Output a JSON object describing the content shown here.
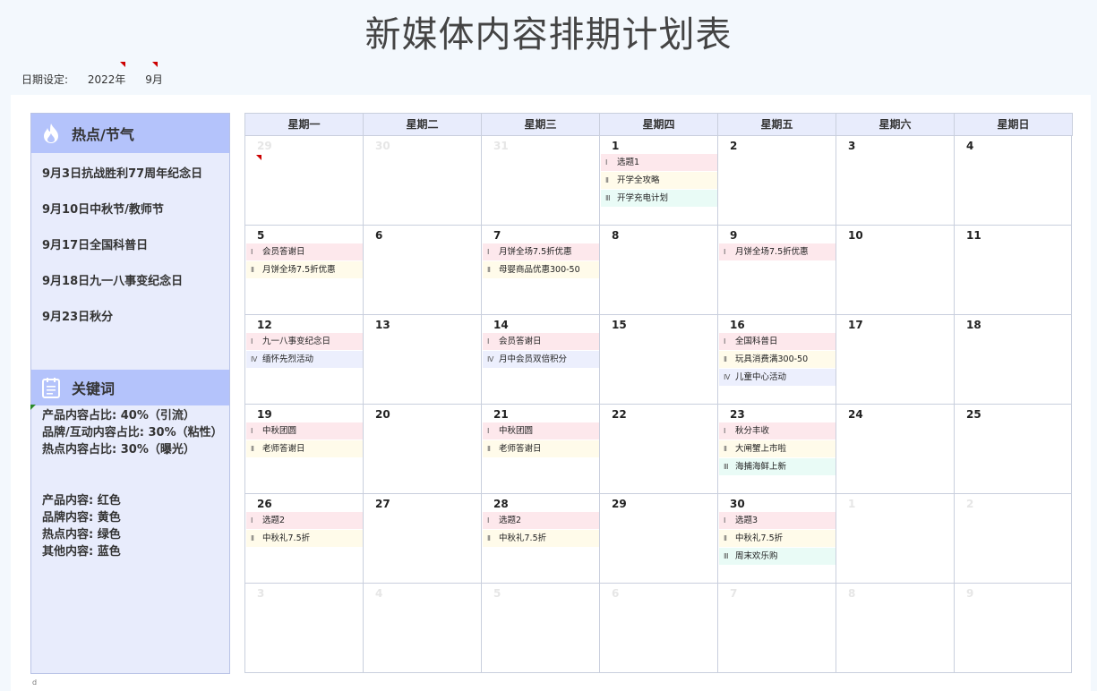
{
  "page": {
    "title": "新媒体内容排期计划表"
  },
  "date_setting": {
    "label": "日期设定:",
    "year": "2022年",
    "month": "9月"
  },
  "hot": {
    "heading": "热点/节气",
    "items": [
      "9月3日抗战胜利77周年纪念日",
      "9月10日中秋节/教师节",
      "9月17日全国科普日",
      "9月18日九一八事变纪念日",
      "9月23日秋分"
    ]
  },
  "keywords": {
    "heading": "关键词",
    "ratios": [
      "产品内容占比: 40%（引流）",
      "品牌/互动内容占比: 30%（粘性）",
      "热点内容占比: 30%（曝光）"
    ],
    "colors": [
      "产品内容: 红色",
      "品牌内容: 黄色",
      "热点内容: 绿色",
      "其他内容: 蓝色"
    ]
  },
  "calendar": {
    "weekdays": [
      "星期一",
      "星期二",
      "星期三",
      "星期四",
      "星期五",
      "星期六",
      "星期日"
    ],
    "weeks": [
      [
        {
          "day": "29",
          "dim": true,
          "events": []
        },
        {
          "day": "30",
          "dim": true,
          "events": []
        },
        {
          "day": "31",
          "dim": true,
          "events": []
        },
        {
          "day": "1",
          "events": [
            {
              "n": "Ⅰ",
              "text": "选题1",
              "c": "c1"
            },
            {
              "n": "Ⅱ",
              "text": "开学全攻略",
              "c": "c2"
            },
            {
              "n": "Ⅲ",
              "text": "开学充电计划",
              "c": "c3"
            }
          ]
        },
        {
          "day": "2",
          "events": []
        },
        {
          "day": "3",
          "events": []
        },
        {
          "day": "4",
          "events": []
        }
      ],
      [
        {
          "day": "5",
          "events": [
            {
              "n": "Ⅰ",
              "text": "会员答谢日",
              "c": "c1"
            },
            {
              "n": "Ⅱ",
              "text": "月饼全场7.5折优惠",
              "c": "c2"
            }
          ]
        },
        {
          "day": "6",
          "events": []
        },
        {
          "day": "7",
          "events": [
            {
              "n": "Ⅰ",
              "text": "月饼全场7.5折优惠",
              "c": "c1"
            },
            {
              "n": "Ⅱ",
              "text": "母婴商品优惠300-50",
              "c": "c2"
            }
          ]
        },
        {
          "day": "8",
          "events": []
        },
        {
          "day": "9",
          "events": [
            {
              "n": "Ⅰ",
              "text": "月饼全场7.5折优惠",
              "c": "c1"
            }
          ]
        },
        {
          "day": "10",
          "events": []
        },
        {
          "day": "11",
          "events": []
        }
      ],
      [
        {
          "day": "12",
          "events": [
            {
              "n": "Ⅰ",
              "text": "九一八事变纪念日",
              "c": "c1"
            },
            {
              "n": "Ⅳ",
              "text": "缅怀先烈活动",
              "c": "c4"
            }
          ]
        },
        {
          "day": "13",
          "events": []
        },
        {
          "day": "14",
          "events": [
            {
              "n": "Ⅰ",
              "text": "会员答谢日",
              "c": "c1"
            },
            {
              "n": "Ⅳ",
              "text": "月中会员双倍积分",
              "c": "c4"
            }
          ]
        },
        {
          "day": "15",
          "events": []
        },
        {
          "day": "16",
          "events": [
            {
              "n": "Ⅰ",
              "text": "全国科普日",
              "c": "c1"
            },
            {
              "n": "Ⅱ",
              "text": "玩具消费满300-50",
              "c": "c2"
            },
            {
              "n": "Ⅳ",
              "text": "儿童中心活动",
              "c": "c4"
            }
          ]
        },
        {
          "day": "17",
          "events": []
        },
        {
          "day": "18",
          "events": []
        }
      ],
      [
        {
          "day": "19",
          "events": [
            {
              "n": "Ⅰ",
              "text": "中秋团圆",
              "c": "c1"
            },
            {
              "n": "Ⅱ",
              "text": "老师答谢日",
              "c": "c2"
            }
          ]
        },
        {
          "day": "20",
          "events": []
        },
        {
          "day": "21",
          "events": [
            {
              "n": "Ⅰ",
              "text": "中秋团圆",
              "c": "c1"
            },
            {
              "n": "Ⅱ",
              "text": "老师答谢日",
              "c": "c2"
            }
          ]
        },
        {
          "day": "22",
          "events": []
        },
        {
          "day": "23",
          "events": [
            {
              "n": "Ⅰ",
              "text": "秋分丰收",
              "c": "c1"
            },
            {
              "n": "Ⅱ",
              "text": "大闸蟹上市啦",
              "c": "c2"
            },
            {
              "n": "Ⅲ",
              "text": "海捕海鲜上新",
              "c": "c3"
            }
          ]
        },
        {
          "day": "24",
          "events": []
        },
        {
          "day": "25",
          "events": []
        }
      ],
      [
        {
          "day": "26",
          "events": [
            {
              "n": "Ⅰ",
              "text": "选题2",
              "c": "c1"
            },
            {
              "n": "Ⅱ",
              "text": "中秋礼7.5折",
              "c": "c2"
            }
          ]
        },
        {
          "day": "27",
          "events": []
        },
        {
          "day": "28",
          "events": [
            {
              "n": "Ⅰ",
              "text": "选题2",
              "c": "c1"
            },
            {
              "n": "Ⅱ",
              "text": "中秋礼7.5折",
              "c": "c2"
            }
          ]
        },
        {
          "day": "29",
          "events": []
        },
        {
          "day": "30",
          "events": [
            {
              "n": "Ⅰ",
              "text": "选题3",
              "c": "c1"
            },
            {
              "n": "Ⅱ",
              "text": "中秋礼7.5折",
              "c": "c2"
            },
            {
              "n": "Ⅲ",
              "text": "周末欢乐购",
              "c": "c3"
            }
          ]
        },
        {
          "day": "1",
          "dim": true,
          "events": []
        },
        {
          "day": "2",
          "dim": true,
          "events": []
        }
      ],
      [
        {
          "day": "3",
          "dim": true,
          "events": []
        },
        {
          "day": "4",
          "dim": true,
          "events": []
        },
        {
          "day": "5",
          "dim": true,
          "events": []
        },
        {
          "day": "6",
          "dim": true,
          "events": []
        },
        {
          "day": "7",
          "dim": true,
          "events": []
        },
        {
          "day": "8",
          "dim": true,
          "events": []
        },
        {
          "day": "9",
          "dim": true,
          "events": []
        }
      ]
    ]
  },
  "footer": {
    "mark": "d"
  }
}
